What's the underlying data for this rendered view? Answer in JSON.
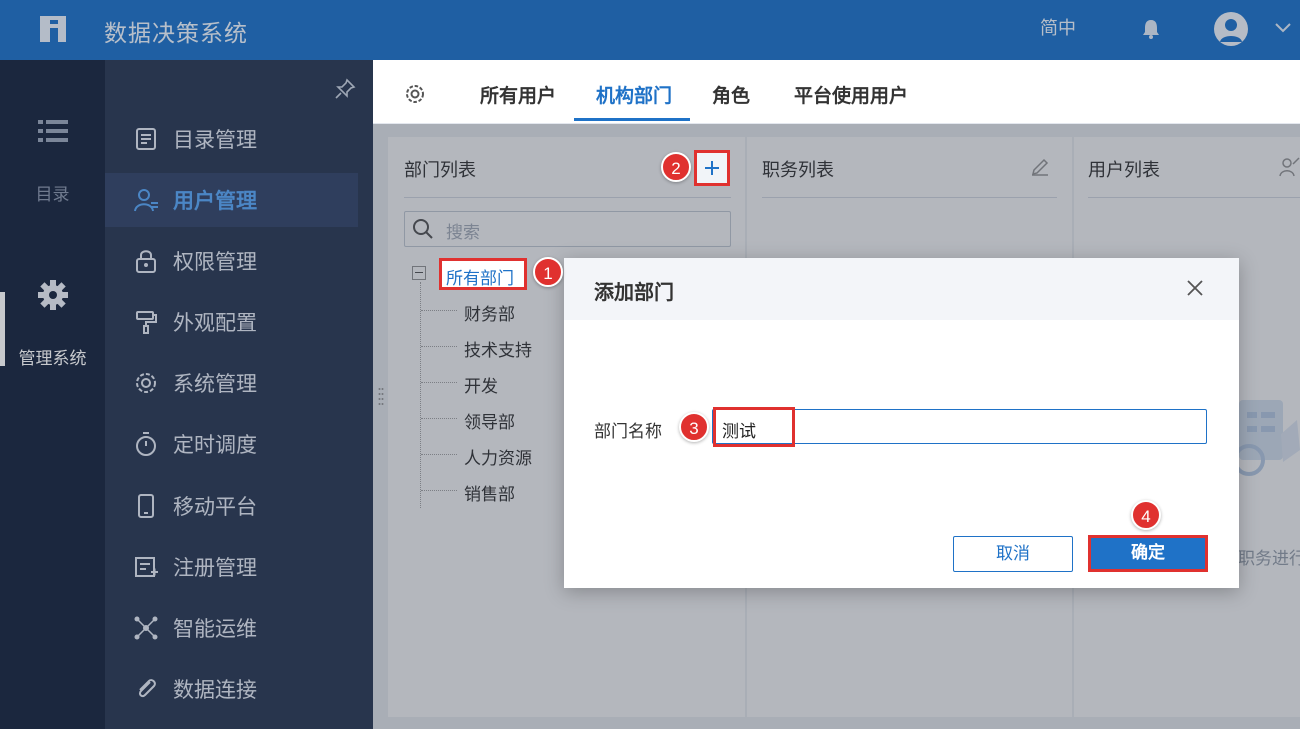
{
  "header": {
    "app_title": "数据决策系统",
    "lang": "简中"
  },
  "rail": {
    "items": [
      {
        "label": "目录",
        "icon": "list-icon"
      },
      {
        "label": "管理系统",
        "icon": "gear-icon",
        "active": true
      }
    ]
  },
  "sidebar": {
    "items": [
      {
        "label": "目录管理",
        "icon": "catalog-icon"
      },
      {
        "label": "用户管理",
        "icon": "user-manage-icon",
        "active": true
      },
      {
        "label": "权限管理",
        "icon": "lock-icon"
      },
      {
        "label": "外观配置",
        "icon": "paint-roller-icon"
      },
      {
        "label": "系统管理",
        "icon": "settings-icon"
      },
      {
        "label": "定时调度",
        "icon": "timer-icon"
      },
      {
        "label": "移动平台",
        "icon": "mobile-icon"
      },
      {
        "label": "注册管理",
        "icon": "register-icon"
      },
      {
        "label": "智能运维",
        "icon": "network-icon"
      },
      {
        "label": "数据连接",
        "icon": "paperclip-icon"
      }
    ]
  },
  "tabs": [
    {
      "label": "所有用户"
    },
    {
      "label": "机构部门",
      "active": true
    },
    {
      "label": "角色"
    },
    {
      "label": "平台使用用户"
    }
  ],
  "dept_panel": {
    "title": "部门列表",
    "search_placeholder": "搜索",
    "tree_root": "所有部门",
    "departments": [
      "财务部",
      "技术支持",
      "开发",
      "领导部",
      "人力资源",
      "销售部"
    ]
  },
  "position_panel": {
    "title": "职务列表"
  },
  "user_panel": {
    "title": "用户列表",
    "empty_hint": "职务进行"
  },
  "dialog": {
    "title": "添加部门",
    "field_label": "部门名称",
    "field_value": "测试",
    "cancel_label": "取消",
    "ok_label": "确定"
  },
  "steps": [
    "1",
    "2",
    "3",
    "4"
  ],
  "colors": {
    "brand": "#1f72c7",
    "highlight": "#e0312f",
    "rail_bg": "#1a2740",
    "sidebar_bg": "#2b3a55"
  }
}
